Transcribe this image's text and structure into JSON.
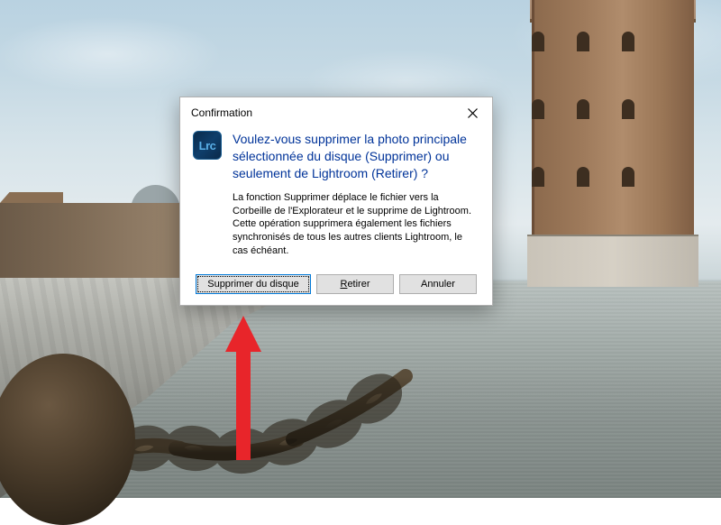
{
  "dialog": {
    "title": "Confirmation",
    "app_icon_label": "Lrc",
    "heading": "Voulez-vous supprimer la photo principale sélectionnée du disque (Supprimer) ou seulement de Lightroom (Retirer) ?",
    "body_text": "La fonction Supprimer déplace le fichier vers la Corbeille de l'Explorateur et le supprime de Lightroom. Cette opération supprimera également les fichiers synchronisés de tous les autres clients Lightroom, le cas échéant.",
    "buttons": {
      "primary": "Supprimer du disque",
      "retirer_prefix": "R",
      "retirer_rest": "etirer",
      "annuler": "Annuler"
    }
  },
  "colors": {
    "link_blue": "#003399",
    "button_focus": "#0078d7",
    "arrow": "#e8252a"
  }
}
